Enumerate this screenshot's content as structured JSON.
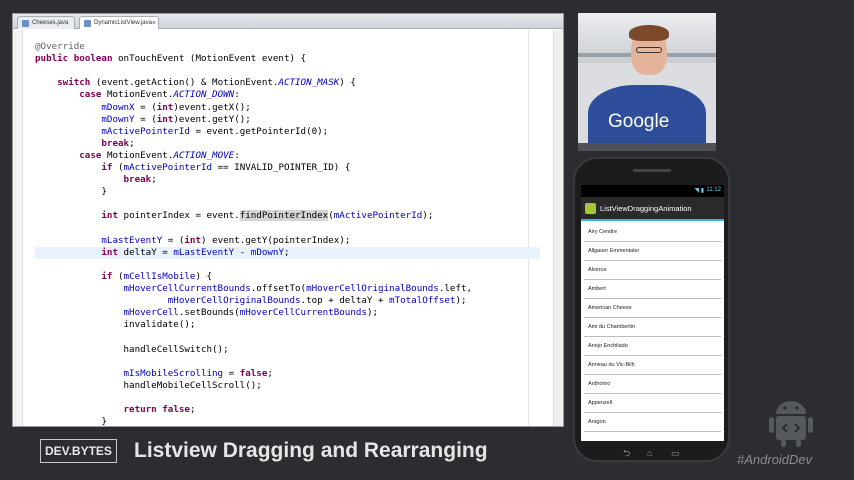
{
  "editor": {
    "tabs": [
      {
        "label": "Cheeses.java",
        "active": false
      },
      {
        "label": "DynamicListView.java",
        "active": true
      }
    ],
    "code_lines": [
      "@Override",
      "public boolean onTouchEvent (MotionEvent event) {",
      "",
      "    switch (event.getAction() & MotionEvent.ACTION_MASK) {",
      "        case MotionEvent.ACTION_DOWN:",
      "            mDownX = (int)event.getX();",
      "            mDownY = (int)event.getY();",
      "            mActivePointerId = event.getPointerId(0);",
      "            break;",
      "        case MotionEvent.ACTION_MOVE:",
      "            if (mActivePointerId == INVALID_POINTER_ID) {",
      "                break;",
      "            }",
      "",
      "            int pointerIndex = event.findPointerIndex(mActivePointerId);",
      "",
      "            mLastEventY = (int) event.getY(pointerIndex);",
      "            int deltaY = mLastEventY - mDownY;",
      "",
      "            if (mCellIsMobile) {",
      "                mHoverCellCurrentBounds.offsetTo(mHoverCellOriginalBounds.left,",
      "                        mHoverCellOriginalBounds.top + deltaY + mTotalOffset);",
      "                mHoverCell.setBounds(mHoverCellCurrentBounds);",
      "                invalidate();",
      "",
      "                handleCellSwitch();",
      "",
      "                mIsMobileScrolling = false;",
      "                handleMobileCellScroll();",
      "",
      "                return false;",
      "            }"
    ]
  },
  "webcam": {
    "shirt_text": "Google"
  },
  "phone": {
    "status_time": "11:12",
    "app_title": "ListViewDraggingAnimation",
    "items": [
      "Airy Cendre",
      "Allgauer Emmentaler",
      "Alverca",
      "Ambert",
      "American Cheese",
      "Ami du Chambertin",
      "Anejo Enchilado",
      "Anneau du Vic-Bilh",
      "Anthoriro",
      "Appenzell",
      "Aragon"
    ]
  },
  "lower_third": {
    "brand": "DEV.BYTES",
    "title": "Listview Dragging and Rearranging"
  },
  "hashtag": "#AndroidDev",
  "colors": {
    "keyword": "#7f0055",
    "field": "#0000c0",
    "accent": "#33b5e5",
    "android_green": "#a4c639"
  }
}
